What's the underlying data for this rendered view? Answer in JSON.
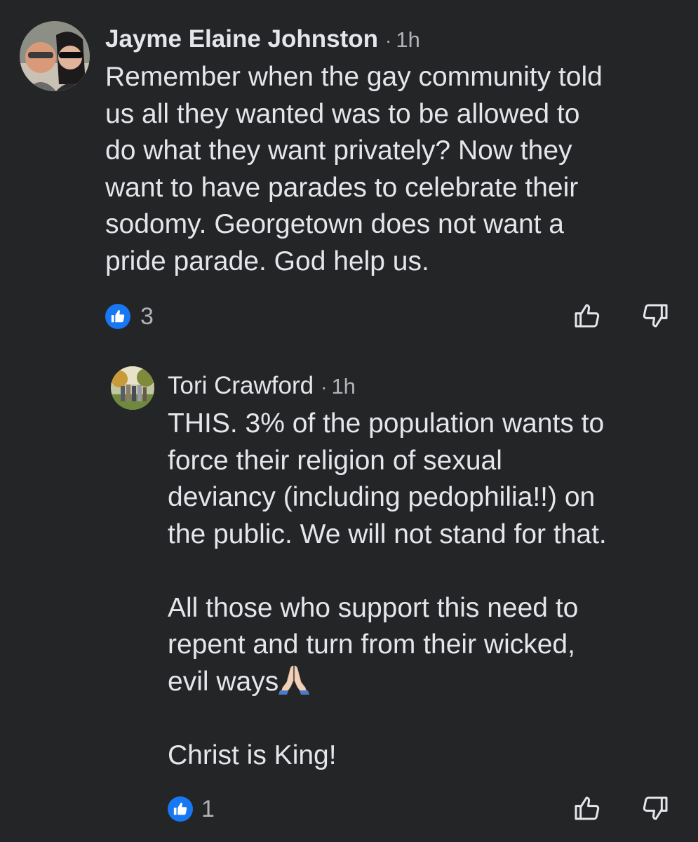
{
  "comments": [
    {
      "author": "Jayme Elaine Johnston",
      "separator": "·",
      "time": "1h",
      "text": "Remember when the gay community told\nus all they wanted was to be allowed to\ndo what they want privately? Now they\nwant to have parades to celebrate their\nsodomy. Georgetown does not want a\npride parade. God help us.",
      "reaction_count": "3",
      "reaction_icon": "like-icon",
      "upvote_icon": "thumbs-up-outline-icon",
      "downvote_icon": "thumbs-down-outline-icon"
    },
    {
      "author": "Tori Crawford",
      "separator": "·",
      "time": "1h",
      "text_lines_before_emoji": "THIS. 3% of the population wants to\nforce their religion of sexual\ndeviancy (including pedophilia!!) on\nthe public. We will not stand for that.\n\nAll those who support this need to\nrepent and turn from their wicked,\nevil ways",
      "emoji": "praying-hands-emoji",
      "text_after_emoji": "\n\nChrist is King!",
      "reaction_count": "1",
      "reaction_icon": "like-icon",
      "upvote_icon": "thumbs-up-outline-icon",
      "downvote_icon": "thumbs-down-outline-icon"
    }
  ],
  "colors": {
    "background": "#242526",
    "text_primary": "#e4e6eb",
    "text_secondary": "#b0b3b8",
    "like_blue": "#1877f2"
  }
}
